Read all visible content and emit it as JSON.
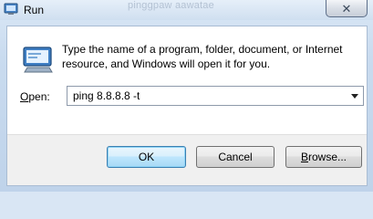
{
  "window": {
    "title": "Run",
    "background_text": "pinggpaw aawatae",
    "close_glyph": "✕"
  },
  "dialog": {
    "description": "Type the name of a program, folder, document, or Internet resource, and Windows will open it for you.",
    "open_label_mnemonic": "O",
    "open_label_rest": "pen:",
    "open_value": "ping 8.8.8.8 -t"
  },
  "buttons": {
    "ok": "OK",
    "cancel": "Cancel",
    "browse_mnemonic": "B",
    "browse_rest": "rowse..."
  },
  "icons": {
    "title": "run-app-icon",
    "dialog": "run-app-icon",
    "dropdown": "chevron-down-icon"
  }
}
